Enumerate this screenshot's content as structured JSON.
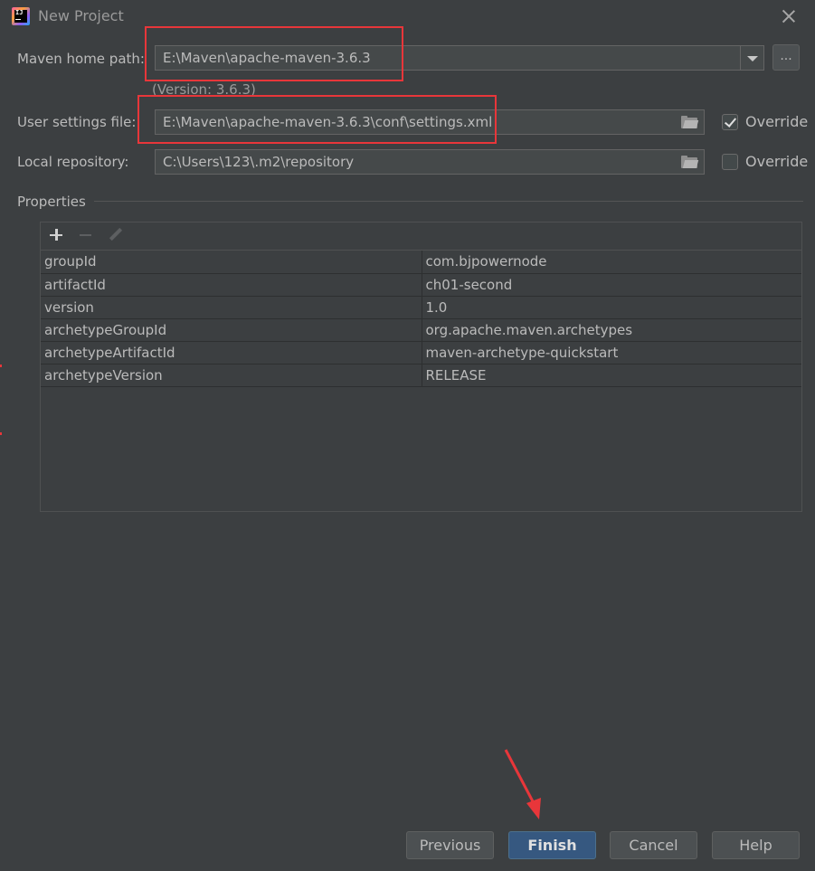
{
  "window": {
    "title": "New Project",
    "logo_text": "IJ"
  },
  "maven_home": {
    "label": "Maven home path:",
    "value": "E:\\Maven\\apache-maven-3.6.3",
    "version_note": "(Version: 3.6.3)",
    "browse_label": "..."
  },
  "user_settings": {
    "label": "User settings file:",
    "value": "E:\\Maven\\apache-maven-3.6.3\\conf\\settings.xml",
    "override_label": "Override",
    "override_checked": true
  },
  "local_repo": {
    "label": "Local repository:",
    "value": "C:\\Users\\123\\.m2\\repository",
    "override_label": "Override",
    "override_checked": false
  },
  "properties": {
    "label": "Properties",
    "rows": [
      {
        "key": "groupId",
        "value": "com.bjpowernode"
      },
      {
        "key": "artifactId",
        "value": "ch01-second"
      },
      {
        "key": "version",
        "value": "1.0"
      },
      {
        "key": "archetypeGroupId",
        "value": "org.apache.maven.archetypes"
      },
      {
        "key": "archetypeArtifactId",
        "value": "maven-archetype-quickstart"
      },
      {
        "key": "archetypeVersion",
        "value": "RELEASE"
      }
    ]
  },
  "buttons": {
    "previous": "Previous",
    "finish": "Finish",
    "cancel": "Cancel",
    "help": "Help"
  },
  "colors": {
    "background": "#3c3f41",
    "accent": "#365880",
    "annotation": "#e8363a"
  }
}
